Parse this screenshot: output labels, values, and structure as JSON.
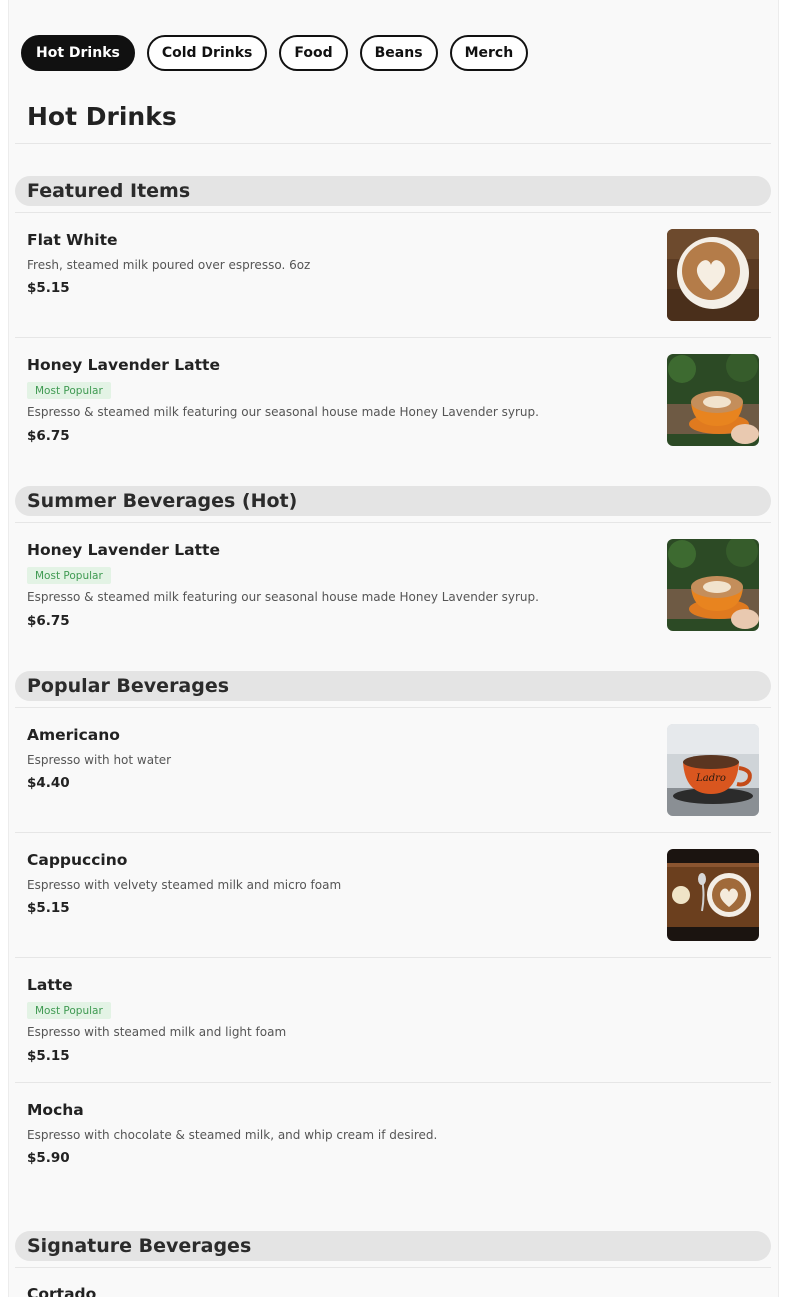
{
  "tabs": [
    {
      "label": "Hot Drinks"
    },
    {
      "label": "Cold Drinks"
    },
    {
      "label": "Food"
    },
    {
      "label": "Beans"
    },
    {
      "label": "Merch"
    }
  ],
  "page_title": "Hot Drinks",
  "sections": [
    {
      "title": "Featured Items",
      "items": [
        {
          "name": "Flat White",
          "badge": "",
          "description": "Fresh, steamed milk poured over espresso. 6oz",
          "price": "$5.15",
          "image": "latte-art-cup-photo"
        },
        {
          "name": "Honey Lavender Latte",
          "badge": "Most Popular",
          "description": "Espresso & steamed milk featuring our seasonal house made Honey Lavender syrup.",
          "price": "$6.75",
          "image": "orange-cup-in-hand-photo"
        }
      ]
    },
    {
      "title": "Summer Beverages (Hot)",
      "items": [
        {
          "name": "Honey Lavender Latte",
          "badge": "Most Popular",
          "description": "Espresso & steamed milk featuring our seasonal house made Honey Lavender syrup.",
          "price": "$6.75",
          "image": "orange-cup-in-hand-photo"
        }
      ]
    },
    {
      "title": "Popular Beverages",
      "items": [
        {
          "name": "Americano",
          "badge": "",
          "description": "Espresso with hot water",
          "price": "$4.40",
          "image": "orange-mug-on-saucer-photo"
        },
        {
          "name": "Cappuccino",
          "badge": "",
          "description": "Espresso with velvety steamed milk and micro foam",
          "price": "$5.15",
          "image": "cappuccino-on-wood-tray-photo"
        },
        {
          "name": "Latte",
          "badge": "Most Popular",
          "description": "Espresso with steamed milk and light foam",
          "price": "$5.15",
          "image": ""
        },
        {
          "name": "Mocha",
          "badge": "",
          "description": "Espresso with chocolate & steamed milk, and whip cream if desired.",
          "price": "$5.90",
          "image": ""
        }
      ]
    },
    {
      "title": "Signature Beverages",
      "items": [
        {
          "name": "Cortado",
          "badge": "",
          "description": "",
          "price": "",
          "image": ""
        }
      ]
    }
  ],
  "photo_text": {
    "mug_brand": "Ladro"
  }
}
